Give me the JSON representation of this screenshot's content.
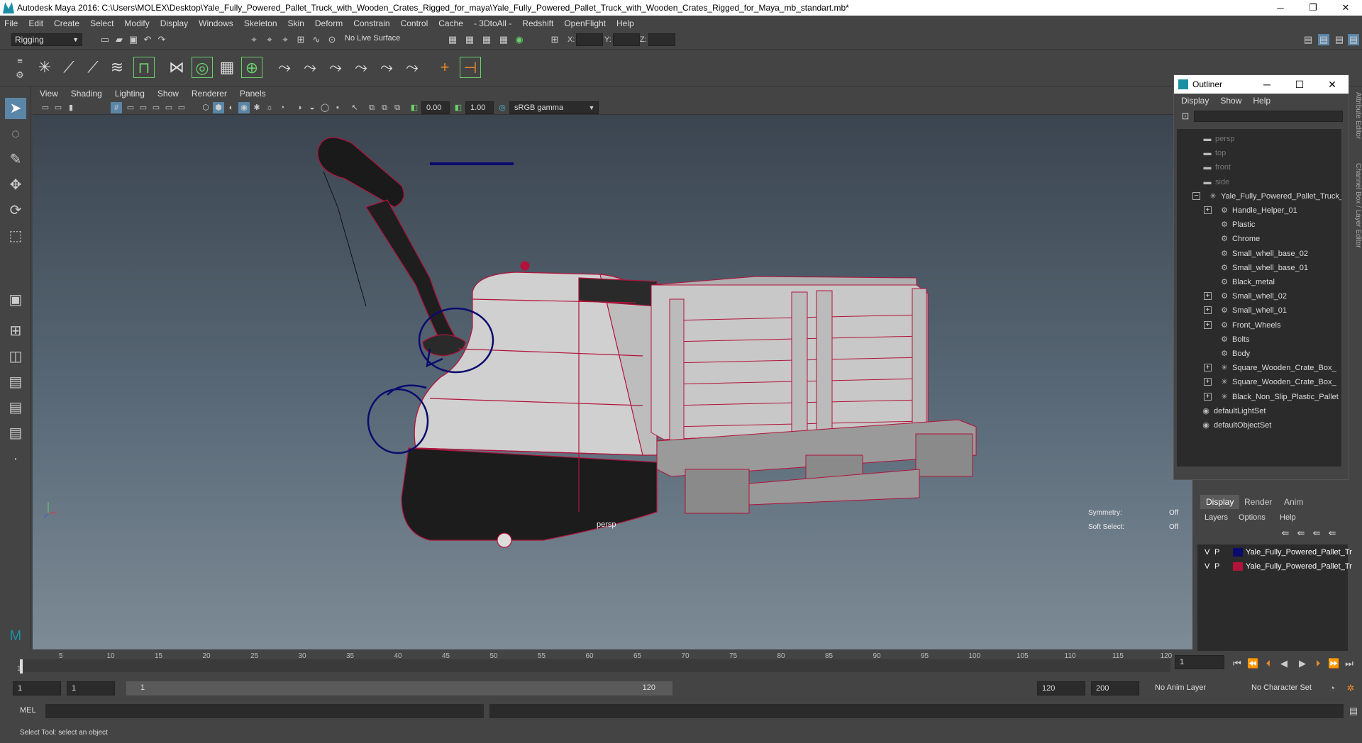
{
  "window": {
    "title": "Autodesk Maya 2016: C:\\Users\\MOLEX\\Desktop\\Yale_Fully_Powered_Pallet_Truck_with_Wooden_Crates_Rigged_for_maya\\Yale_Fully_Powered_Pallet_Truck_with_Wooden_Crates_Rigged_for_Maya_mb_standart.mb*",
    "minimize": "─",
    "restore": "❐",
    "close": "✕"
  },
  "menubar": [
    "File",
    "Edit",
    "Create",
    "Select",
    "Modify",
    "Display",
    "Windows",
    "Skeleton",
    "Skin",
    "Deform",
    "Constrain",
    "Control",
    "Cache",
    "- 3DtoAll -",
    "Redshift",
    "OpenFlight",
    "Help"
  ],
  "statusline": {
    "mode": "Rigging",
    "live_surface": "No Live Surface",
    "x_label": "X:",
    "y_label": "Y:",
    "z_label": "Z:"
  },
  "viewport_menu": [
    "View",
    "Shading",
    "Lighting",
    "Show",
    "Renderer",
    "Panels"
  ],
  "viewport_toolbar": {
    "value1": "0.00",
    "value2": "1.00",
    "color_space": "sRGB gamma"
  },
  "viewport": {
    "camera": "persp",
    "symmetry_label": "Symmetry:",
    "symmetry_value": "Off",
    "soft_select_label": "Soft Select:",
    "soft_select_value": "Off"
  },
  "outliner": {
    "title": "Outliner",
    "menu": [
      "Display",
      "Show",
      "Help"
    ],
    "items": [
      {
        "label": "persp",
        "icon": "camera-icon",
        "dim": true,
        "expander": ""
      },
      {
        "label": "top",
        "icon": "camera-icon",
        "dim": true,
        "expander": ""
      },
      {
        "label": "front",
        "icon": "camera-icon",
        "dim": true,
        "expander": ""
      },
      {
        "label": "side",
        "icon": "camera-icon",
        "dim": true,
        "expander": ""
      },
      {
        "label": "Yale_Fully_Powered_Pallet_Truck_",
        "icon": "joint-icon",
        "dim": false,
        "expander": "−"
      },
      {
        "label": "Handle_Helper_01",
        "icon": "mesh-icon",
        "dim": false,
        "expander": "+"
      },
      {
        "label": "Plastic",
        "icon": "mesh-icon",
        "dim": false,
        "expander": ""
      },
      {
        "label": "Chrome",
        "icon": "mesh-icon",
        "dim": false,
        "expander": ""
      },
      {
        "label": "Small_whell_base_02",
        "icon": "mesh-icon",
        "dim": false,
        "expander": ""
      },
      {
        "label": "Small_whell_base_01",
        "icon": "mesh-icon",
        "dim": false,
        "expander": ""
      },
      {
        "label": "Black_metal",
        "icon": "mesh-icon",
        "dim": false,
        "expander": ""
      },
      {
        "label": "Small_whell_02",
        "icon": "mesh-icon",
        "dim": false,
        "expander": "+"
      },
      {
        "label": "Small_whell_01",
        "icon": "mesh-icon",
        "dim": false,
        "expander": "+"
      },
      {
        "label": "Front_Wheels",
        "icon": "mesh-icon",
        "dim": false,
        "expander": "+"
      },
      {
        "label": "Bolts",
        "icon": "mesh-icon",
        "dim": false,
        "expander": ""
      },
      {
        "label": "Body",
        "icon": "mesh-icon",
        "dim": false,
        "expander": ""
      },
      {
        "label": "Square_Wooden_Crate_Box_",
        "icon": "joint-icon",
        "dim": false,
        "expander": "+"
      },
      {
        "label": "Square_Wooden_Crate_Box_",
        "icon": "joint-icon",
        "dim": false,
        "expander": "+"
      },
      {
        "label": "Black_Non_Slip_Plastic_Pallet",
        "icon": "joint-icon",
        "dim": false,
        "expander": "+"
      },
      {
        "label": "defaultLightSet",
        "icon": "set-icon",
        "dim": false,
        "expander": ""
      },
      {
        "label": "defaultObjectSet",
        "icon": "set-icon",
        "dim": false,
        "expander": ""
      }
    ]
  },
  "layer_panel": {
    "tabs": [
      "Display",
      "Render",
      "Anim"
    ],
    "menu": [
      "Layers",
      "Options",
      "Help"
    ],
    "layers": [
      {
        "v": "V",
        "p": "P",
        "name": "Yale_Fully_Powered_Pallet_Tr",
        "color": "#0b0b6e"
      },
      {
        "v": "V",
        "p": "P",
        "name": "Yale_Fully_Powered_Pallet_Tr",
        "color": "#b3123a"
      }
    ]
  },
  "timeline": {
    "ticks": [
      "5",
      "10",
      "15",
      "20",
      "25",
      "30",
      "35",
      "40",
      "45",
      "50",
      "55",
      "60",
      "65",
      "70",
      "75",
      "80",
      "85",
      "90",
      "95",
      "100",
      "105",
      "110",
      "115",
      "120"
    ],
    "current_frame": "1",
    "start_marker": "1"
  },
  "range": {
    "start": "1",
    "inner_start": "1",
    "slider_start": "1",
    "slider_end": "120",
    "end": "120",
    "outer_end": "200",
    "anim_layer": "No Anim Layer",
    "character_set": "No Character Set"
  },
  "cmdline": {
    "label": "MEL"
  },
  "helpline": {
    "text": "Select Tool: select an object"
  },
  "side_tabs": [
    "Attribute Editor",
    "Channel Box / Layer Editor"
  ]
}
